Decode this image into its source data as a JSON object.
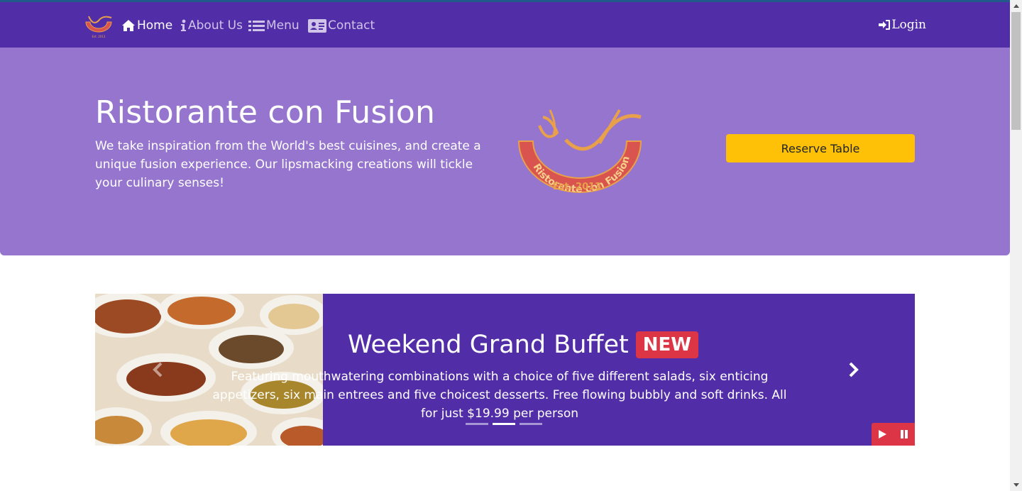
{
  "navbar": {
    "brand_icon": "restaurant-logo",
    "items": [
      {
        "label": "Home",
        "icon": "home-icon",
        "active": true
      },
      {
        "label": "About Us",
        "icon": "info-icon",
        "active": false
      },
      {
        "label": "Menu",
        "icon": "list-icon",
        "active": false
      },
      {
        "label": "Contact",
        "icon": "address-card-icon",
        "active": false
      }
    ],
    "login_label": "Login",
    "login_icon": "sign-in-icon"
  },
  "jumbotron": {
    "title": "Ristorante con Fusion",
    "text": "We take inspiration from the World's best cuisines, and create a unique fusion experience. Our lipsmacking creations will tickle your culinary senses!",
    "logo_text": "Ristorante con Fusion",
    "logo_est": "Est. 2013",
    "reserve_label": "Reserve Table"
  },
  "carousel": {
    "title": "Weekend Grand Buffet",
    "badge": "NEW",
    "text": "Featuring mouthwatering combinations with a choice of five different salads, six enticing appetizers, six main entrees and five choicest desserts. Free flowing bubbly and soft drinks. All for just $19.99 per person",
    "indicator_count": 3,
    "active_indicator": 1
  },
  "colors": {
    "primary": "#512da8",
    "primary_light": "#9575cd",
    "accent": "#ffc107",
    "danger": "#dc3545"
  }
}
